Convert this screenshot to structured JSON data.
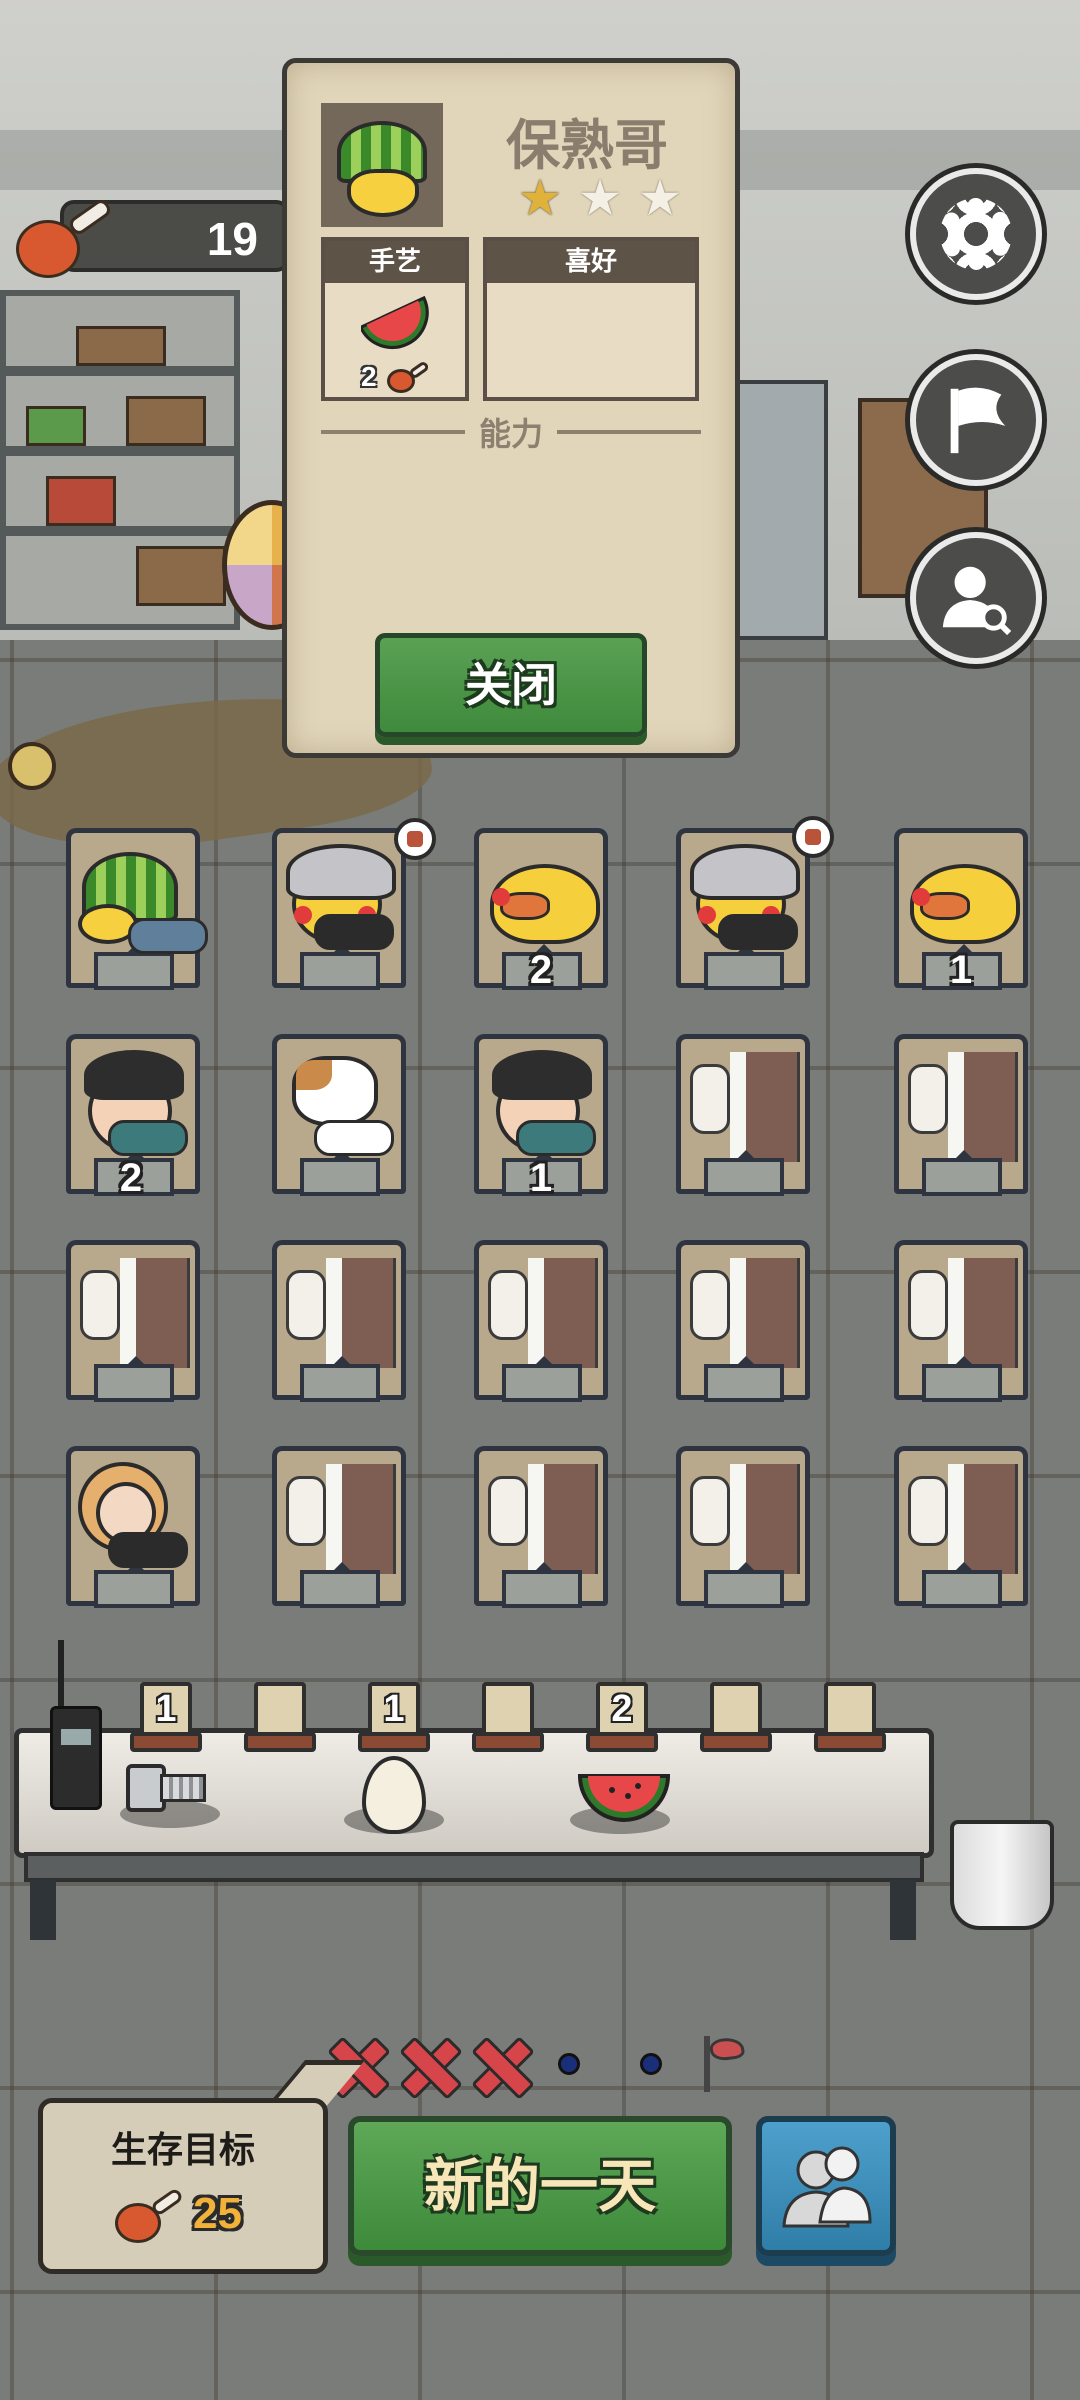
{
  "hud": {
    "food_count": "19",
    "food_icon": "meat-drumstick-icon"
  },
  "side_buttons": [
    {
      "name": "settings",
      "icon": "gear-icon"
    },
    {
      "name": "flag",
      "icon": "flag-icon"
    },
    {
      "name": "profile-search",
      "icon": "person-search-icon"
    }
  ],
  "popup": {
    "character_name": "保熟哥",
    "stars_filled": 1,
    "stars_total": 3,
    "tab_craft_label": "手艺",
    "tab_pref_label": "喜好",
    "craft_item_icon": "watermelon-icon",
    "craft_cost": "2",
    "ability_label": "能力",
    "close_label": "关闭"
  },
  "beds": {
    "row1": [
      {
        "occupant": "watermelon-head",
        "count": ""
      },
      {
        "occupant": "gray-hair-duck",
        "count": "",
        "bubble": true
      },
      {
        "occupant": "yellow-duck",
        "count": "2"
      },
      {
        "occupant": "gray-hair-duck",
        "count": "",
        "bubble": true
      },
      {
        "occupant": "yellow-duck",
        "count": "1"
      }
    ],
    "row2": [
      {
        "occupant": "glasses-man",
        "count": "2"
      },
      {
        "occupant": "calico-cat",
        "count": ""
      },
      {
        "occupant": "glasses-man",
        "count": "1"
      },
      {
        "occupant": "empty",
        "count": ""
      },
      {
        "occupant": "empty",
        "count": ""
      }
    ]
  },
  "bed_counts": {
    "r1c3": "2",
    "r1c5": "1",
    "r2c1": "2",
    "r2c3": "1"
  },
  "table": {
    "slots": [
      "1",
      "",
      "1",
      "",
      "2",
      "",
      ""
    ],
    "items": [
      "walkie-talkie-icon",
      "bolt-icon",
      "egg-icon",
      "watermelon-icon",
      "bucket-icon"
    ]
  },
  "progress": {
    "failed_days": 3,
    "pending_days": 2,
    "goal_flag_icon": "red-flag-icon"
  },
  "goal": {
    "title": "生存目标",
    "value": "25"
  },
  "buttons": {
    "new_day_label": "新的一天",
    "people_icon": "people-icon"
  },
  "colors": {
    "green_button": "#4a9a46",
    "blue_button": "#3a8ebb",
    "popup_bg": "#e2d6ba",
    "x_mark": "#d6454a",
    "star_gold": "#e0b23a"
  }
}
